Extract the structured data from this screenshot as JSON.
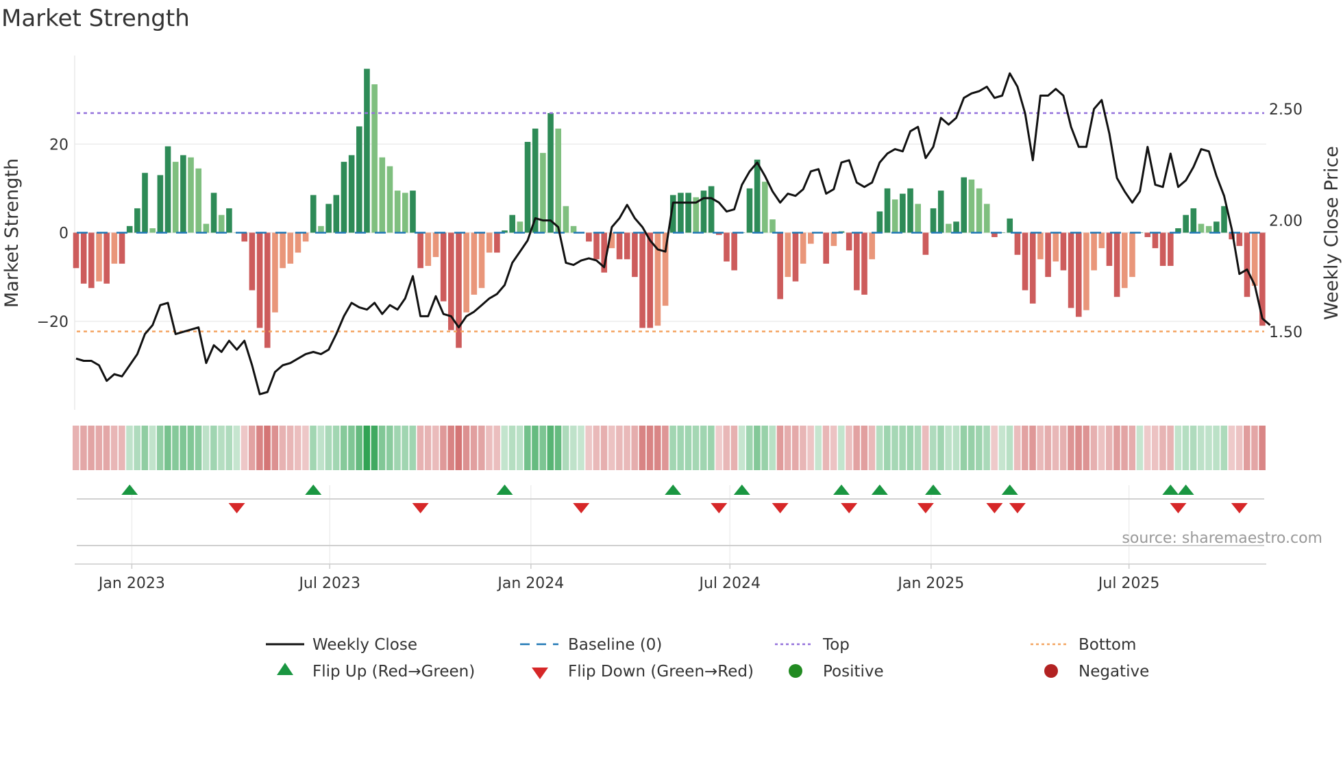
{
  "chart_data": {
    "type": "bar",
    "title": "Market Strength",
    "ylabel": "Market Strength",
    "y2label": "Weekly Close Price",
    "ylim": [
      -40,
      40
    ],
    "y2lim": [
      1.15,
      2.74
    ],
    "yticks": [
      {
        "v": 20,
        "label": "20"
      },
      {
        "v": 0,
        "label": "0"
      },
      {
        "v": -20,
        "label": "−20"
      }
    ],
    "y2ticks": [
      {
        "v": 2.5,
        "label": "2.50"
      },
      {
        "v": 2.0,
        "label": "2.00"
      },
      {
        "v": 1.5,
        "label": "1.50"
      }
    ],
    "start_date": "2022-11-11",
    "step_days": 7,
    "xticks": [
      {
        "date": "2023-01-01",
        "label": "Jan 2023"
      },
      {
        "date": "2023-07-01",
        "label": "Jul 2023"
      },
      {
        "date": "2024-01-01",
        "label": "Jan 2024"
      },
      {
        "date": "2024-07-01",
        "label": "Jul 2024"
      },
      {
        "date": "2025-01-01",
        "label": "Jan 2025"
      },
      {
        "date": "2025-07-01",
        "label": "Jul 2025"
      }
    ],
    "top_level": 27,
    "bottom_level": -22.3,
    "strength": [
      -8,
      -11.5,
      -12.5,
      -11,
      -11.5,
      -7,
      -7,
      1.5,
      5.5,
      13.5,
      1,
      13,
      19.5,
      16,
      17.5,
      17,
      14.5,
      2,
      9,
      4,
      5.5,
      0,
      -2,
      -13,
      -21.5,
      -26,
      -18,
      -8,
      -7,
      -4.5,
      -2,
      8.5,
      1.5,
      6.5,
      8.5,
      16,
      17.5,
      24,
      37,
      33.5,
      17,
      15,
      9.5,
      9,
      9.5,
      -8,
      -7.5,
      -5.5,
      -15.5,
      -22,
      -26,
      -18,
      -14,
      -12.5,
      -4.5,
      -4.5,
      0.5,
      4,
      2.5,
      20.5,
      23.5,
      18,
      27,
      23.5,
      6,
      1.5,
      0,
      -2,
      -6,
      -9,
      -3.5,
      -6,
      -6,
      -10,
      -21.5,
      -21.5,
      -21,
      -16.5,
      8.5,
      9,
      9,
      8,
      9.5,
      10.5,
      -0.5,
      -6.5,
      -8.5,
      0,
      10,
      16.5,
      11.5,
      3,
      -15,
      -10,
      -11,
      -7,
      -2.5,
      0,
      -7,
      -3,
      0.3,
      -4,
      -13,
      -14,
      -6,
      4.8,
      10,
      7.5,
      8.8,
      10,
      6.5,
      -5,
      5.5,
      9.5,
      2,
      2.5,
      12.5,
      12,
      10,
      6.5,
      -1,
      0,
      3.2,
      -5,
      -13,
      -16,
      -6,
      -10,
      -6.5,
      -8.5,
      -17,
      -19,
      -17.5,
      -8.5,
      -3.5,
      -7.5,
      -14.5,
      -12.5,
      -10,
      0,
      -1,
      -3.5,
      -7.5,
      -7.5,
      1,
      4,
      5.5,
      2,
      1.5,
      2.5,
      6,
      -1.5,
      -3,
      -14.5,
      -12,
      -21
    ],
    "weekly_close": [
      1.38,
      1.37,
      1.37,
      1.35,
      1.28,
      1.31,
      1.3,
      1.35,
      1.4,
      1.49,
      1.53,
      1.62,
      1.63,
      1.49,
      1.5,
      1.51,
      1.52,
      1.36,
      1.44,
      1.41,
      1.46,
      1.42,
      1.46,
      1.35,
      1.22,
      1.23,
      1.32,
      1.35,
      1.36,
      1.38,
      1.4,
      1.41,
      1.4,
      1.42,
      1.49,
      1.57,
      1.63,
      1.61,
      1.6,
      1.63,
      1.58,
      1.62,
      1.6,
      1.65,
      1.75,
      1.57,
      1.57,
      1.66,
      1.58,
      1.57,
      1.52,
      1.57,
      1.59,
      1.62,
      1.65,
      1.67,
      1.71,
      1.81,
      1.86,
      1.91,
      2.01,
      2.0,
      2.0,
      1.97,
      1.81,
      1.8,
      1.82,
      1.83,
      1.82,
      1.79,
      1.97,
      2.01,
      2.07,
      2.01,
      1.97,
      1.91,
      1.87,
      1.86,
      2.08,
      2.08,
      2.08,
      2.08,
      2.1,
      2.1,
      2.08,
      2.04,
      2.05,
      2.16,
      2.22,
      2.26,
      2.2,
      2.13,
      2.08,
      2.12,
      2.11,
      2.14,
      2.22,
      2.23,
      2.12,
      2.14,
      2.26,
      2.27,
      2.17,
      2.15,
      2.17,
      2.26,
      2.3,
      2.32,
      2.31,
      2.4,
      2.42,
      2.28,
      2.33,
      2.46,
      2.43,
      2.46,
      2.55,
      2.57,
      2.58,
      2.6,
      2.55,
      2.56,
      2.66,
      2.6,
      2.48,
      2.27,
      2.56,
      2.56,
      2.59,
      2.56,
      2.42,
      2.33,
      2.33,
      2.5,
      2.54,
      2.39,
      2.19,
      2.13,
      2.08,
      2.13,
      2.33,
      2.16,
      2.15,
      2.3,
      2.15,
      2.18,
      2.24,
      2.32,
      2.31,
      2.2,
      2.11,
      1.96,
      1.76,
      1.78,
      1.71,
      1.56,
      1.53
    ],
    "flip_up": [
      "2022-12-30",
      "2023-06-16",
      "2023-12-08",
      "2024-05-10",
      "2024-07-12",
      "2024-10-11",
      "2024-11-15",
      "2025-01-03",
      "2025-03-14",
      "2025-08-08",
      "2025-08-22"
    ],
    "flip_down": [
      "2023-04-07",
      "2023-09-22",
      "2024-02-16",
      "2024-06-21",
      "2024-08-16",
      "2024-10-18",
      "2024-12-27",
      "2025-02-28",
      "2025-03-21",
      "2025-08-15",
      "2025-10-10"
    ],
    "colors": {
      "pos_strong": "#2e8b57",
      "pos_weak": "#7fbf7f",
      "neg_strong": "#cd5c5c",
      "neg_weak": "#e9967a",
      "baseline": "#1f77b4",
      "top": "#9370db",
      "bottom": "#f4a460",
      "close": "#111111",
      "flip_up": "#1a9641",
      "flip_down": "#d62728",
      "positive": "#228b22",
      "negative": "#b22222"
    },
    "legend": {
      "weekly_close": "Weekly Close",
      "baseline": "Baseline (0)",
      "top": "Top",
      "bottom": "Bottom",
      "flip_up": "Flip Up (Red→Green)",
      "flip_down": "Flip Down (Green→Red)",
      "positive": "Positive",
      "negative": "Negative"
    },
    "source": "source: sharemaestro.com"
  }
}
